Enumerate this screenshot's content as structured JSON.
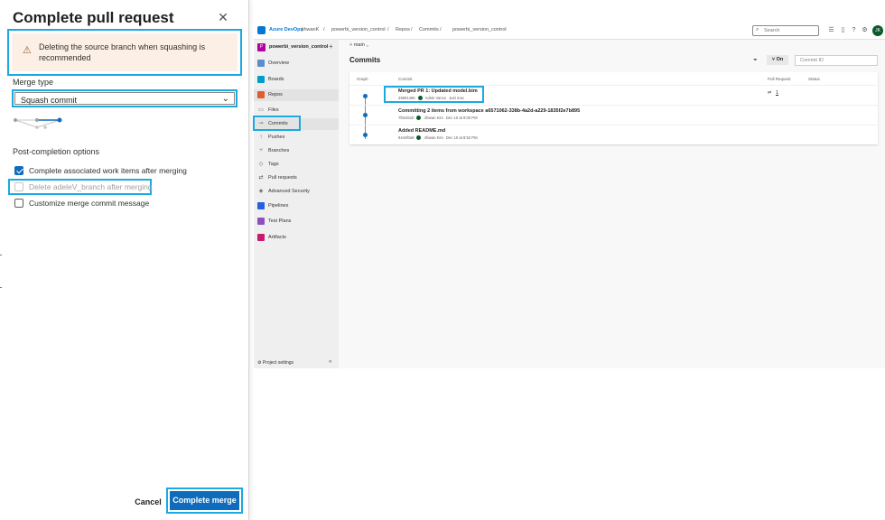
{
  "dialog": {
    "title": "Complete pull request",
    "close_icon": "close-icon",
    "warning_icon": "warning-icon",
    "warning_text": "Deleting the source branch when squashing is recommended",
    "merge_type_label": "Merge type",
    "merge_type_value": "Squash commit",
    "post_completion_label": "Post-completion options",
    "options": [
      {
        "label": "Complete associated work items after merging",
        "checked": true,
        "disabled": false
      },
      {
        "label": "Delete adeleV_branch after merging",
        "checked": false,
        "disabled": true
      },
      {
        "label": "Customize merge commit message",
        "checked": false,
        "disabled": false
      }
    ],
    "cancel_label": "Cancel",
    "complete_label": "Complete merge"
  },
  "ado": {
    "brand": "Azure DevOps",
    "breadcrumbs": [
      "jihwanK",
      "/",
      "powerbi_version_control",
      "/",
      "Repos",
      "/",
      "Commits",
      "/",
      "powerbi_version_control"
    ],
    "search_placeholder": "Search",
    "avatar_initials": "JK",
    "project_badge": "P",
    "project_name": "powerbi_version_control",
    "nav": [
      {
        "label": "Overview",
        "color": "#5c8dc6"
      },
      {
        "label": "Boards",
        "color": "#009ccc"
      },
      {
        "label": "Repos",
        "color": "#e05b30"
      },
      {
        "label": "Files",
        "sub": true
      },
      {
        "label": "Commits",
        "sub": true
      },
      {
        "label": "Pushes",
        "sub": true
      },
      {
        "label": "Branches",
        "sub": true
      },
      {
        "label": "Tags",
        "sub": true
      },
      {
        "label": "Pull requests",
        "sub": true
      },
      {
        "label": "Advanced Security",
        "sub": true
      },
      {
        "label": "Pipelines",
        "color": "#2560e0"
      },
      {
        "label": "Test Plans",
        "color": "#8f4fc1"
      },
      {
        "label": "Artifacts",
        "color": "#c81b6e"
      }
    ],
    "project_settings": "Project settings",
    "branch": "main",
    "page_title": "Commits",
    "on_label": "On",
    "commit_id_placeholder": "Commit ID",
    "columns": [
      "Graph",
      "Commit",
      "Pull Request",
      "Status"
    ],
    "commits": [
      {
        "title": "Merged PR 1: Updated model.bim",
        "hash": "49691466",
        "author": "Adele Vance",
        "when": "Just now",
        "pr": "1"
      },
      {
        "title": "Committing 2 items from workspace a6571062-338b-4a2d-a229-1835f2e7b895",
        "hash": "7f0e4b1b",
        "author": "Jihwan Kim",
        "when": "Dec 10 at 9:00 PM",
        "pr": ""
      },
      {
        "title": "Added README.md",
        "hash": "9444f0a9",
        "author": "Jihwan Kim",
        "when": "Dec 10 at 8:52 PM",
        "pr": ""
      }
    ]
  }
}
